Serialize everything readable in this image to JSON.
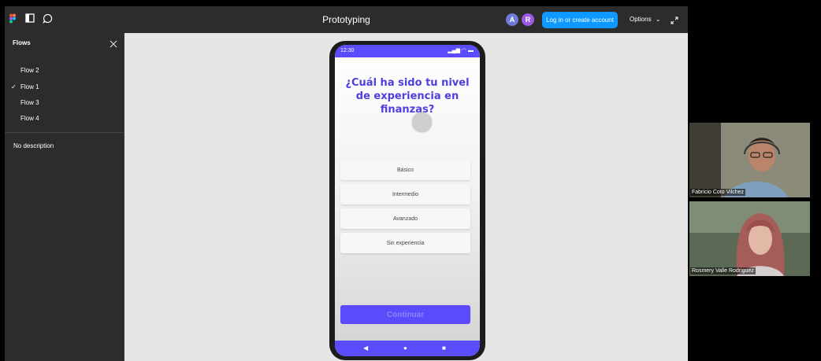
{
  "window": {
    "title": "Prototyping",
    "icons": [
      "figma-logo-icon",
      "panel-toggle-icon",
      "comment-icon"
    ],
    "avatars": [
      {
        "initial": "A",
        "color": "#6f7bd8"
      },
      {
        "initial": "R",
        "color": "#9b59e6"
      }
    ],
    "login_label": "Log in or create account",
    "options_label": "Options",
    "accent": "#0d99ff"
  },
  "sidebar": {
    "title": "Flows",
    "flows": [
      {
        "label": "Flow 2",
        "selected": false
      },
      {
        "label": "Flow 1",
        "selected": true
      },
      {
        "label": "Flow 3",
        "selected": false
      },
      {
        "label": "Flow 4",
        "selected": false
      }
    ],
    "description": "No description"
  },
  "phone": {
    "time": "12:30",
    "question": "¿Cuál ha sido tu nivel de experiencia en finanzas?",
    "options": [
      "Básico",
      "Intermedio",
      "Avanzado",
      "Sin experiencia"
    ],
    "continue_label": "Continuar",
    "nav_icons": [
      "back-triangle-icon",
      "home-circle-icon",
      "recents-square-icon"
    ],
    "brand_color": "#5b4cfb"
  },
  "participants": [
    {
      "name": "Fabricio Coto Vilchez"
    },
    {
      "name": "Rosmery Valle Rodriguez"
    }
  ]
}
